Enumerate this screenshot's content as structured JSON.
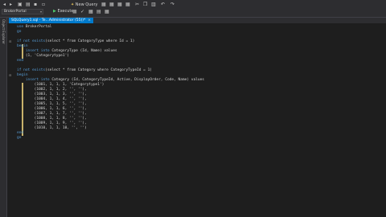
{
  "toolbar": {
    "new_query": "New Query",
    "database": "BrokerPortal",
    "execute": "Execute"
  },
  "sidebar": {
    "label": "Object Explorer"
  },
  "tab": {
    "title": "SQLQuery1.sql - Te...Administrator (55))*",
    "close": "×"
  },
  "code_lines": [
    {
      "kw": "use",
      "rest": " BrokerPortal"
    },
    {
      "kw": "go",
      "rest": ""
    },
    {
      "kw": "",
      "rest": ""
    },
    {
      "kw": "if not exists",
      "rest": "(select * from CategoryType where Id = 1)"
    },
    {
      "kw": "begin",
      "rest": ""
    },
    {
      "kw": "    insert into",
      "rest": " CategoryType (Id, Name) values"
    },
    {
      "kw": "",
      "rest": "    (1, 'Categorytype1')"
    },
    {
      "kw": "end",
      "rest": ""
    },
    {
      "kw": "",
      "rest": ""
    },
    {
      "kw": "if not exists",
      "rest": "(select * from Category where CategoryTypeId = 1)"
    },
    {
      "kw": "begin",
      "rest": ""
    },
    {
      "kw": "    insert into",
      "rest": " Category (Id, CategoryTypeId, Active, DisplayOrder, Code, Name) values"
    },
    {
      "kw": "",
      "rest": "        (1001, 1, 1, 1, 'Categorytype1')"
    },
    {
      "kw": "",
      "rest": "        (1002, 1, 1, 2, '', ''),"
    },
    {
      "kw": "",
      "rest": "        (1003, 1, 1, 3, '', ''),"
    },
    {
      "kw": "",
      "rest": "        (1004, 1, 1, 4, '', ''),"
    },
    {
      "kw": "",
      "rest": "        (1005, 1, 1, 5, '', ''),"
    },
    {
      "kw": "",
      "rest": "        (1006, 1, 1, 6, '', ''),"
    },
    {
      "kw": "",
      "rest": "        (1007, 1, 1, 7, '', ''),"
    },
    {
      "kw": "",
      "rest": "        (1008, 1, 1, 8, '', ''),"
    },
    {
      "kw": "",
      "rest": "        (1009, 1, 1, 9, '', ''),"
    },
    {
      "kw": "",
      "rest": "        (1010, 1, 1, 10, '', '')"
    },
    {
      "kw": "end",
      "rest": ""
    },
    {
      "kw": "go",
      "rest": ""
    }
  ]
}
